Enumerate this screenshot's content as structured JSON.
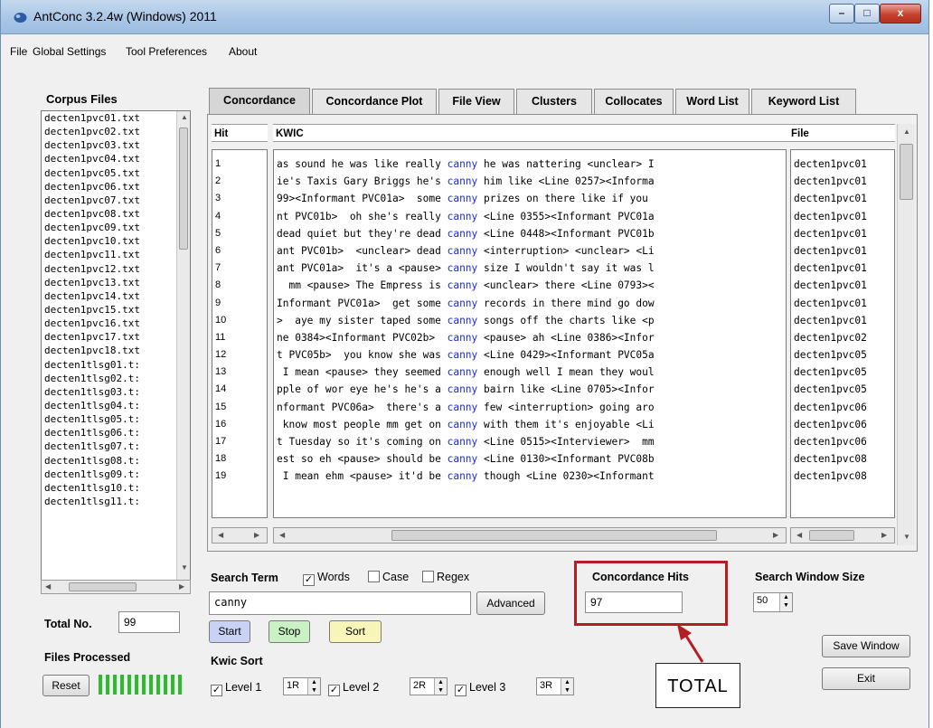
{
  "window": {
    "title": "AntConc 3.2.4w (Windows) 2011",
    "controls": {
      "minimize": "–",
      "maximize": "□",
      "close": "x"
    }
  },
  "menu": [
    "File",
    "Global Settings",
    "Tool Preferences",
    "About"
  ],
  "corpus": {
    "heading": "Corpus Files",
    "files": [
      "decten1pvc01.txt",
      "decten1pvc02.txt",
      "decten1pvc03.txt",
      "decten1pvc04.txt",
      "decten1pvc05.txt",
      "decten1pvc06.txt",
      "decten1pvc07.txt",
      "decten1pvc08.txt",
      "decten1pvc09.txt",
      "decten1pvc10.txt",
      "decten1pvc11.txt",
      "decten1pvc12.txt",
      "decten1pvc13.txt",
      "decten1pvc14.txt",
      "decten1pvc15.txt",
      "decten1pvc16.txt",
      "decten1pvc17.txt",
      "decten1pvc18.txt",
      "decten1tlsg01.t:",
      "decten1tlsg02.t:",
      "decten1tlsg03.t:",
      "decten1tlsg04.t:",
      "decten1tlsg05.t:",
      "decten1tlsg06.t:",
      "decten1tlsg07.t:",
      "decten1tlsg08.t:",
      "decten1tlsg09.t:",
      "decten1tlsg10.t:",
      "decten1tlsg11.t:"
    ],
    "total_label": "Total No.",
    "total_value": "99",
    "processed_label": "Files Processed",
    "reset_label": "Reset"
  },
  "tabs": [
    "Concordance",
    "Concordance Plot",
    "File View",
    "Clusters",
    "Collocates",
    "Word List",
    "Keyword List"
  ],
  "concordance": {
    "headers": {
      "hit": "Hit",
      "kwic": "KWIC",
      "file": "File"
    },
    "keyword": "canny",
    "rows": [
      {
        "hit": "1",
        "left": "as sound he was like really ",
        "right": " he was nattering <unclear> I",
        "file": "decten1pvc01"
      },
      {
        "hit": "2",
        "left": "ie's Taxis Gary Briggs he's ",
        "right": " him like <Line 0257><Informa",
        "file": "decten1pvc01"
      },
      {
        "hit": "3",
        "left": "99><Informant PVC01a>  some ",
        "right": " prizes on there like if you ",
        "file": "decten1pvc01"
      },
      {
        "hit": "4",
        "left": "nt PVC01b>  oh she's really ",
        "right": " <Line 0355><Informant PVC01a",
        "file": "decten1pvc01"
      },
      {
        "hit": "5",
        "left": "dead quiet but they're dead ",
        "right": " <Line 0448><Informant PVC01b",
        "file": "decten1pvc01"
      },
      {
        "hit": "6",
        "left": "ant PVC01b>  <unclear> dead ",
        "right": " <interruption> <unclear> <Li",
        "file": "decten1pvc01"
      },
      {
        "hit": "7",
        "left": "ant PVC01a>  it's a <pause> ",
        "right": " size I wouldn't say it was l",
        "file": "decten1pvc01"
      },
      {
        "hit": "8",
        "left": "  mm <pause> The Empress is ",
        "right": " <unclear> there <Line 0793><",
        "file": "decten1pvc01"
      },
      {
        "hit": "9",
        "left": "Informant PVC01a>  get some ",
        "right": " records in there mind go dow",
        "file": "decten1pvc01"
      },
      {
        "hit": "10",
        "left": ">  aye my sister taped some ",
        "right": " songs off the charts like <p",
        "file": "decten1pvc01"
      },
      {
        "hit": "11",
        "left": "ne 0384><Informant PVC02b>  ",
        "right": " <pause> ah <Line 0386><Infor",
        "file": "decten1pvc02"
      },
      {
        "hit": "12",
        "left": "t PVC05b>  you know she was ",
        "right": " <Line 0429><Informant PVC05a",
        "file": "decten1pvc05"
      },
      {
        "hit": "13",
        "left": " I mean <pause> they seemed ",
        "right": " enough well I mean they woul",
        "file": "decten1pvc05"
      },
      {
        "hit": "14",
        "left": "pple of wor eye he's he's a ",
        "right": " bairn like <Line 0705><Infor",
        "file": "decten1pvc05"
      },
      {
        "hit": "15",
        "left": "nformant PVC06a>  there's a ",
        "right": " few <interruption> going aro",
        "file": "decten1pvc06"
      },
      {
        "hit": "16",
        "left": " know most people mm get on ",
        "right": " with them it's enjoyable <Li",
        "file": "decten1pvc06"
      },
      {
        "hit": "17",
        "left": "t Tuesday so it's coming on ",
        "right": " <Line 0515><Interviewer>  mm",
        "file": "decten1pvc06"
      },
      {
        "hit": "18",
        "left": "est so eh <pause> should be ",
        "right": " <Line 0130><Informant PVC08b",
        "file": "decten1pvc08"
      },
      {
        "hit": "19",
        "left": " I mean ehm <pause> it'd be ",
        "right": " though <Line 0230><Informant",
        "file": "decten1pvc08"
      }
    ]
  },
  "search": {
    "label": "Search Term",
    "words_label": "Words",
    "case_label": "Case",
    "regex_label": "Regex",
    "term": "canny",
    "advanced_label": "Advanced",
    "start_label": "Start",
    "stop_label": "Stop",
    "sort_label": "Sort",
    "words_checked": true,
    "case_checked": false,
    "regex_checked": false
  },
  "hits": {
    "label": "Concordance Hits",
    "value": "97"
  },
  "window_size": {
    "label": "Search Window Size",
    "value": "50"
  },
  "kwic_sort": {
    "label": "Kwic Sort",
    "levels": [
      {
        "label": "Level 1",
        "value": "1R"
      },
      {
        "label": "Level 2",
        "value": "2R"
      },
      {
        "label": "Level 3",
        "value": "3R"
      }
    ]
  },
  "actions": {
    "save_window": "Save Window",
    "exit": "Exit"
  },
  "annotation": {
    "total": "TOTAL"
  },
  "colors": {
    "keyword": "#1b29d6",
    "start_button": "#c8d2f5",
    "stop_button": "#c9f1c4",
    "sort_button": "#f7f5b8",
    "annotation": "#b11e24",
    "progress": "#2fbb2f"
  }
}
